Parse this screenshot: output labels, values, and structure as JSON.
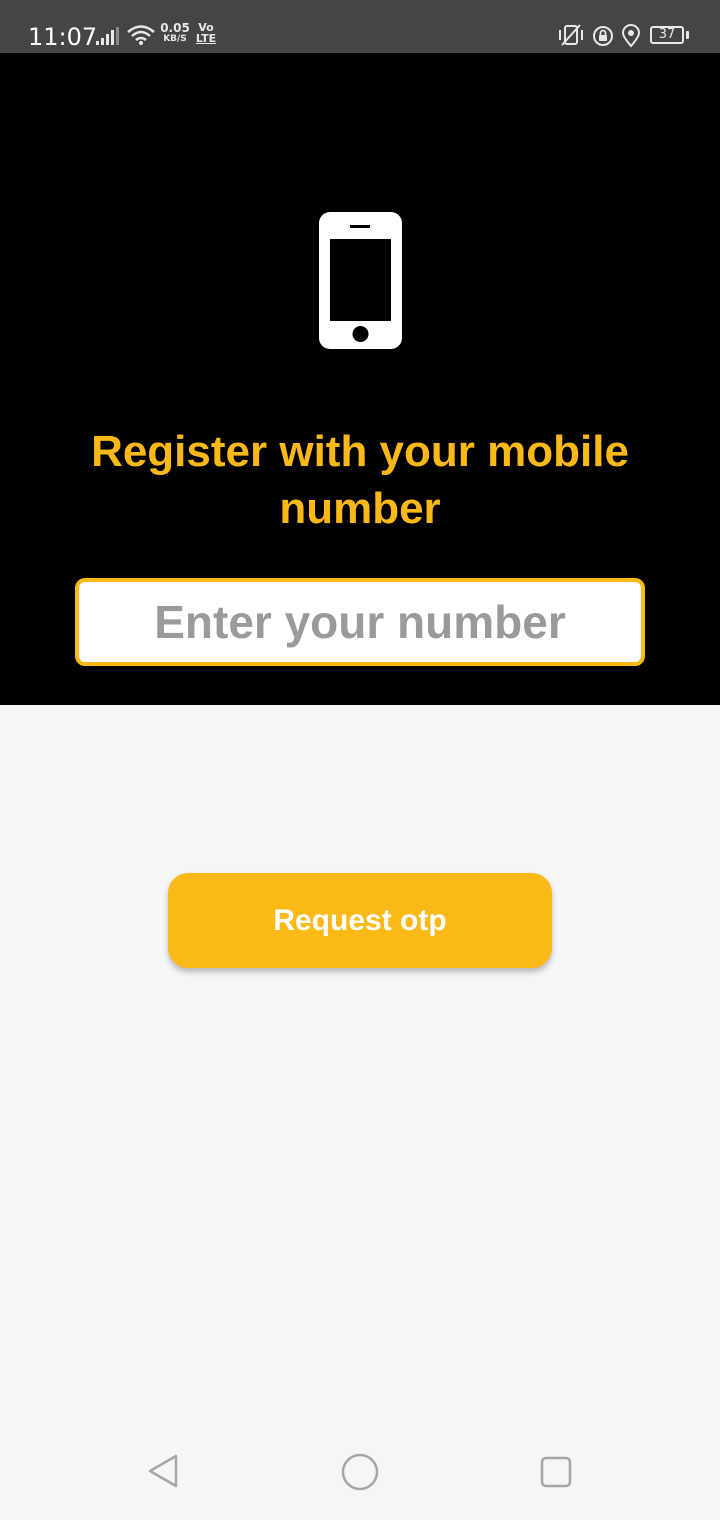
{
  "status_bar": {
    "time": "11:07",
    "speed_value": "0.05",
    "speed_unit": "KB/S",
    "volte_top": "Vo",
    "volte_bottom": "LTE",
    "battery": "37",
    "icons": [
      "signal-icon",
      "wifi-icon",
      "vibrate-icon",
      "lock-rotation-icon",
      "location-icon",
      "battery-icon"
    ]
  },
  "hero": {
    "icon": "mobile-phone-icon",
    "title": "Register with your mobile number",
    "input_placeholder": "Enter your number",
    "input_value": ""
  },
  "actions": {
    "request_label": "Request otp"
  },
  "nav_bar": {
    "icons": [
      "back-icon",
      "home-icon",
      "recents-icon"
    ]
  },
  "colors": {
    "accent": "#fbb917",
    "hero_background": "#000000",
    "page_background": "#f6f6f6",
    "status_bar": "#454545"
  }
}
